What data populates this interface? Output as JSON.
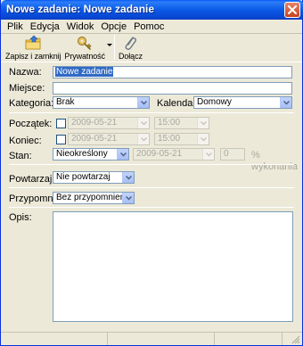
{
  "window": {
    "title": "Nowe zadanie: Nowe zadanie"
  },
  "menu": [
    {
      "label": "Plik"
    },
    {
      "label": "Edycja"
    },
    {
      "label": "Widok"
    },
    {
      "label": "Opcje"
    },
    {
      "label": "Pomoc"
    }
  ],
  "toolbar": {
    "save": {
      "label": "Zapisz i zamknij",
      "icon": "folder-save-icon"
    },
    "privacy": {
      "label": "Prywatność",
      "icon": "key-icon"
    },
    "attach": {
      "label": "Dołącz",
      "icon": "paperclip-icon"
    }
  },
  "form": {
    "title_label": "Nazwa:",
    "title_value": "Nowe zadanie",
    "location_label": "Miejsce:",
    "location_value": "",
    "category_label": "Kategoria:",
    "category_value": "Brak",
    "calendar_label": "Kalendarz:",
    "calendar_value": "Domowy",
    "start_label": "Początek:",
    "start_date": "2009-05-21",
    "start_time": "15:00",
    "due_label": "Koniec:",
    "due_date": "2009-05-21",
    "due_time": "15:00",
    "status_label": "Stan:",
    "status_value": "Nieokreślony",
    "status_date": "2009-05-21",
    "percent_value": "0",
    "percent_label": "% wykonania",
    "repeat_label": "Powtarzaj:",
    "repeat_value": "Nie powtarzaj",
    "reminder_label": "Przypomnij:",
    "reminder_value": "Bez przypomnienia",
    "description_label": "Opis:",
    "description_value": ""
  },
  "colors": {
    "titlebar": "#0a5ae8",
    "selection": "#316ac5",
    "window_bg": "#ece9d8"
  }
}
